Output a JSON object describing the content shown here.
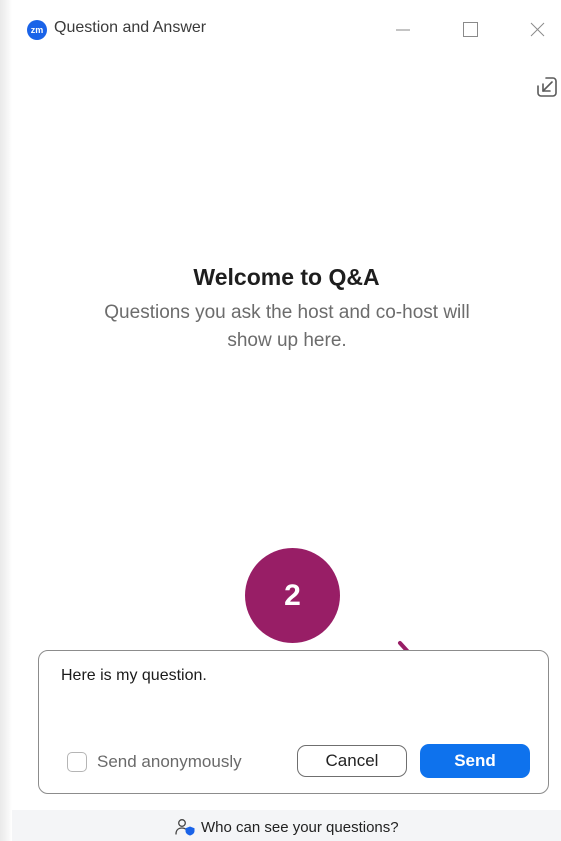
{
  "window": {
    "title": "Question and Answer",
    "logo_text": "zm"
  },
  "welcome": {
    "title": "Welcome to Q&A",
    "text": "Questions you ask the host and co-host will show up here."
  },
  "compose": {
    "question_text": "Here is my question.",
    "anonymous_label": "Send anonymously",
    "anonymous_checked": false,
    "cancel_label": "Cancel",
    "send_label": "Send"
  },
  "annotation": {
    "step_number": "2",
    "color": "#981e66"
  },
  "footer": {
    "link_text": "Who can see your questions?"
  },
  "colors": {
    "send_button": "#0e72ed",
    "logo": "#1a63e8"
  },
  "icons": [
    "minimize-icon",
    "maximize-icon",
    "close-icon",
    "popout-icon",
    "people-shield-icon"
  ]
}
